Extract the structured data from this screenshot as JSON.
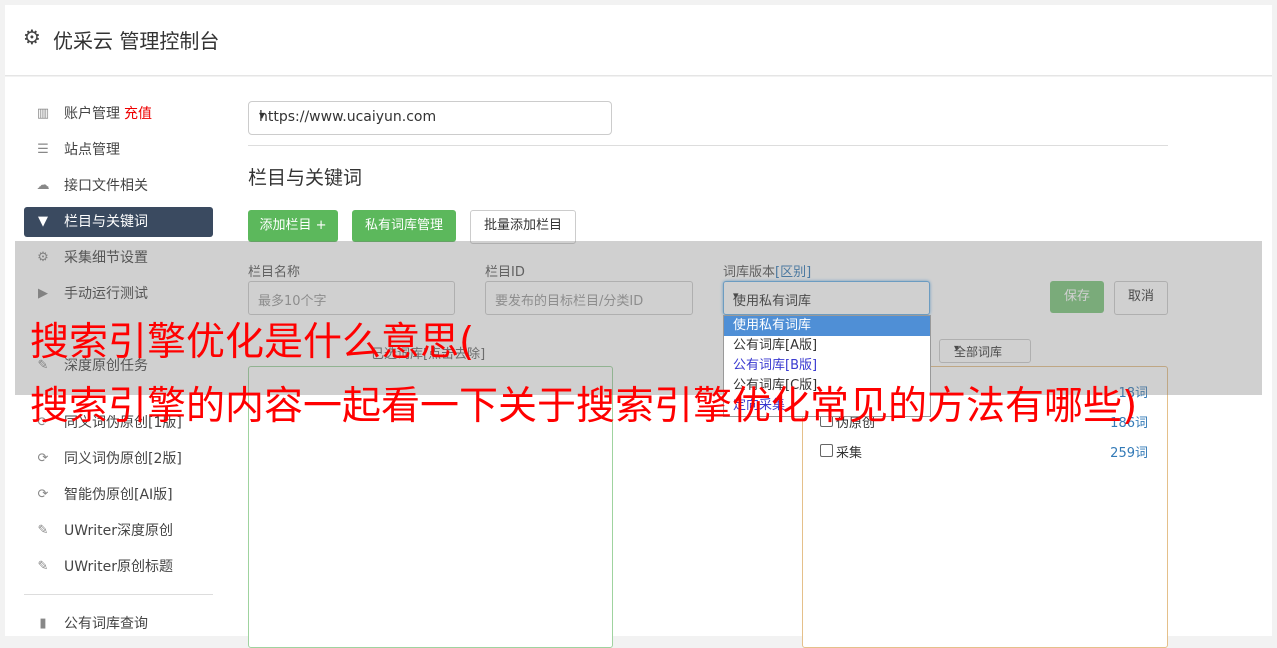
{
  "header": {
    "title": "优采云 管理控制台",
    "icon": "gear-icon"
  },
  "sidebar": {
    "items": [
      {
        "label": "账户管理",
        "extra": "充值",
        "icon": "bar-chart-icon"
      },
      {
        "label": "站点管理",
        "icon": "server-icon"
      },
      {
        "label": "接口文件相关",
        "icon": "cloud-upload-icon"
      },
      {
        "label": "栏目与关键词",
        "icon": "filter-icon",
        "active": true
      },
      {
        "label": "采集细节设置",
        "icon": "cogs-icon"
      },
      {
        "label": "手动运行测试",
        "icon": "play-circle-icon"
      },
      {
        "label": "深度原创任务",
        "icon": "edit-icon"
      },
      {
        "label": "同义词伪原创[1版]",
        "icon": "refresh-icon"
      },
      {
        "label": "同义词伪原创[2版]",
        "icon": "refresh-icon"
      },
      {
        "label": "智能伪原创[AI版]",
        "icon": "refresh-icon"
      },
      {
        "label": "UWriter深度原创",
        "icon": "edit-icon"
      },
      {
        "label": "UWriter原创标题",
        "icon": "edit-icon"
      },
      {
        "label": "公有词库查询",
        "icon": "book-icon"
      }
    ]
  },
  "main": {
    "site_select": "https://www.ucaiyun.com",
    "section_title": "栏目与关键词",
    "buttons": {
      "add_column": "添加栏目 +",
      "private_lib": "私有词库管理",
      "batch_add": "批量添加栏目"
    },
    "form": {
      "name_label": "栏目名称",
      "name_placeholder": "最多10个字",
      "id_label": "栏目ID",
      "id_placeholder": "要发布的目标栏目/分类ID",
      "version_label": "词库版本",
      "version_link": "[区别]",
      "version_value": "使用私有词库",
      "save": "保存",
      "cancel": "取消"
    },
    "dropdown_options": [
      "使用私有词库",
      "公有词库[A版]",
      "公有词库[B版]",
      "公有词库[C版]",
      "定向采集"
    ],
    "panel_title": "已选词库[点击去除]",
    "lib_filter": "全部词库",
    "libraries": [
      {
        "name": "原创",
        "count": "18词"
      },
      {
        "name": "伪原创",
        "count": "186词"
      },
      {
        "name": "采集",
        "count": "259词"
      }
    ]
  },
  "banner": {
    "line1": "搜索引擎优化是什么意思(",
    "line2": "搜索引擎的内容一起看一下关于搜索引擎优化常见的方法有哪些)"
  }
}
